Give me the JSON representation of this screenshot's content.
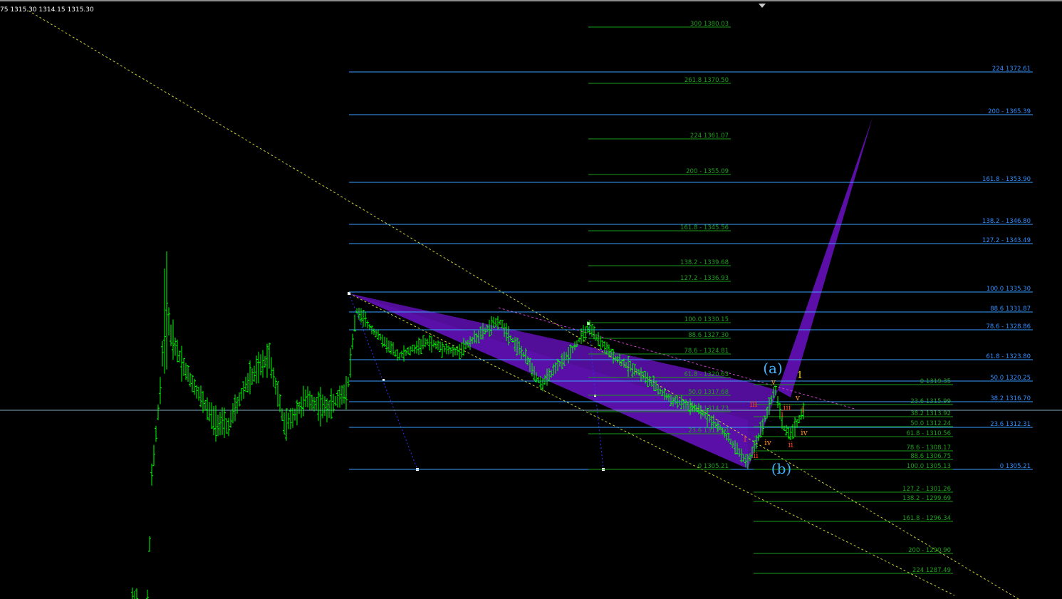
{
  "header": {
    "ohlc": "75 1315.30 1314.15 1315.30"
  },
  "colors": {
    "background": "#000000",
    "bar": "#00ff00",
    "fib_blue": "#3aa0ff",
    "fib_green": "#1a9a1a",
    "label_blue": "#2f8fff",
    "label_green": "#1f9f1f",
    "wedge": "#5b0fa8",
    "trend_yellow": "#cccc33",
    "trend_magenta": "#d040d0",
    "wave_red": "#ff3b1f",
    "wave_orange": "#ff8c1a",
    "wave_yellow": "#ffd21f",
    "wave_cyan": "#3fb2ff",
    "crosshair": "#7fb0c8"
  },
  "chart_data": {
    "type": "ohlc",
    "y_range": [
      1284.5,
      1385.0
    ],
    "price_samples": [
      {
        "label": "ohlc-last",
        "value": 1315.3
      }
    ],
    "fib_levels_blue": [
      {
        "label": "224 1372.61",
        "value": 1372.61
      },
      {
        "label": "200 - 1365.39",
        "value": 1365.39
      },
      {
        "label": "161.8 - 1353.90",
        "value": 1353.9
      },
      {
        "label": "138.2 - 1346.80",
        "value": 1346.8
      },
      {
        "label": "127.2 - 1343.49",
        "value": 1343.49
      },
      {
        "label": "100.0 1335.30",
        "value": 1335.3
      },
      {
        "label": "88.6 1331.87",
        "value": 1331.87
      },
      {
        "label": "78.6 - 1328.86",
        "value": 1328.86
      },
      {
        "label": "61.8 - 1323.80",
        "value": 1323.8
      },
      {
        "label": "50.0 1320.25",
        "value": 1320.25
      },
      {
        "label": "38.2 1316.70",
        "value": 1316.7
      },
      {
        "label": "23.6 1312.31",
        "value": 1312.31
      },
      {
        "label": "0 1305.21",
        "value": 1305.21
      }
    ],
    "fib_levels_green_upper": [
      {
        "label": "300 1380.03",
        "value": 1380.03
      },
      {
        "label": "261.8 1370.50",
        "value": 1370.5
      },
      {
        "label": "224 1361.07",
        "value": 1361.07
      },
      {
        "label": "200 - 1355.09",
        "value": 1355.09
      },
      {
        "label": "161.8 - 1345.56",
        "value": 1345.56
      },
      {
        "label": "138.2 - 1339.68",
        "value": 1339.68
      },
      {
        "label": "127.2 - 1336.93",
        "value": 1336.93
      },
      {
        "label": "100.0 1330.15",
        "value": 1330.15
      },
      {
        "label": "88.6 1327.30",
        "value": 1327.3
      },
      {
        "label": "78.6 - 1324.81",
        "value": 1324.81
      },
      {
        "label": "61.8 - 1320.63",
        "value": 1320.63
      },
      {
        "label": "50.0 1317.68",
        "value": 1317.68
      },
      {
        "label": "38.2 1314.73",
        "value": 1314.73
      },
      {
        "label": "23.6 1311.10",
        "value": 1311.1
      },
      {
        "label": "0 1305.21",
        "value": 1305.21
      }
    ],
    "fib_levels_green_lower": [
      {
        "label": "0 1319.35",
        "value": 1319.35
      },
      {
        "label": "23.6 1315.99",
        "value": 1315.99
      },
      {
        "label": "38.2 1313.92",
        "value": 1313.92
      },
      {
        "label": "50.0 1312.24",
        "value": 1312.24
      },
      {
        "label": "61.8 - 1310.56",
        "value": 1310.56
      },
      {
        "label": "78.6 - 1308.17",
        "value": 1308.17
      },
      {
        "label": "88.6 1306.75",
        "value": 1306.75
      },
      {
        "label": "100.0 1305.13",
        "value": 1305.13
      },
      {
        "label": "127.2 - 1301.26",
        "value": 1301.26
      },
      {
        "label": "138.2 - 1299.69",
        "value": 1299.69
      },
      {
        "label": "161.8 - 1296.34",
        "value": 1296.34
      },
      {
        "label": "200 - 1290.90",
        "value": 1290.9
      },
      {
        "label": "224 1287.49",
        "value": 1287.49
      }
    ],
    "wave_labels": [
      {
        "text": "(a)",
        "color": "cyan"
      },
      {
        "text": "(b)",
        "color": "cyan"
      },
      {
        "text": "1",
        "color": "yellow"
      },
      {
        "text": "v",
        "color": "orange"
      },
      {
        "text": "v",
        "color": "orange"
      },
      {
        "text": "iv",
        "color": "orange"
      },
      {
        "text": "iv",
        "color": "orange"
      },
      {
        "text": "iii",
        "color": "red"
      },
      {
        "text": "iii",
        "color": "red"
      },
      {
        "text": "ii",
        "color": "red"
      },
      {
        "text": "ii",
        "color": "red"
      },
      {
        "text": "i",
        "color": "red"
      },
      {
        "text": "i",
        "color": "red"
      },
      {
        "text": "i",
        "color": "red"
      }
    ]
  }
}
